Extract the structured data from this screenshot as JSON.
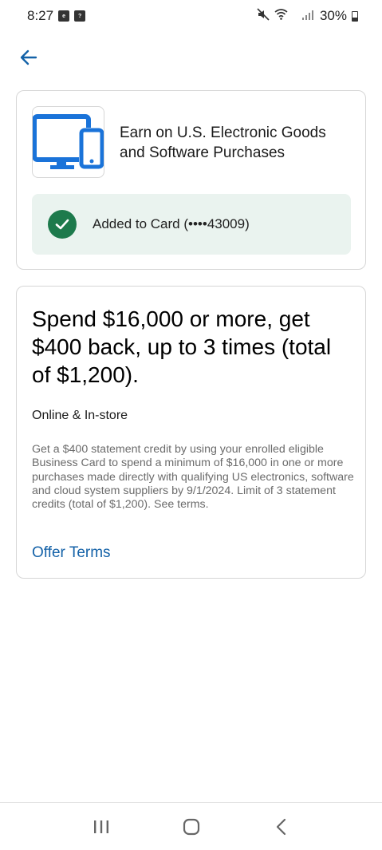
{
  "status_bar": {
    "time": "8:27",
    "notification_icons": [
      "ebay-icon",
      "help-box-icon"
    ],
    "status_icons": [
      "mute-icon",
      "wifi-icon",
      "4g-signal-icon"
    ],
    "network": "4G",
    "battery": "30%"
  },
  "header": {
    "back_icon": "arrow-left-icon"
  },
  "offer_card": {
    "title": "Earn on U.S. Electronic Goods and Software Purchases",
    "image_icon": "devices-icon",
    "added_label": "Added to Card (••••43009)",
    "added_icon": "check-circle-icon"
  },
  "details_card": {
    "headline": "Spend $16,000 or more, get $400 back, up to 3 times (total of $1,200).",
    "channel": "Online & In-store",
    "description": "Get a $400 statement credit by using your enrolled eligible Business Card to spend a minimum of $16,000 in one or more purchases made directly with qualifying US electronics, software and cloud system suppliers by 9/1/2024. Limit of 3 statement credits (total of $1,200). See terms.",
    "terms_link": "Offer Terms"
  },
  "nav_bar": {
    "buttons": [
      "recents-icon",
      "home-icon",
      "back-icon"
    ]
  },
  "colors": {
    "accent_blue": "#1462a8",
    "icon_blue": "#1a73d9",
    "success_green": "#1d7a4c",
    "success_bg": "#eaf3ef",
    "border": "#d6d6d6"
  }
}
